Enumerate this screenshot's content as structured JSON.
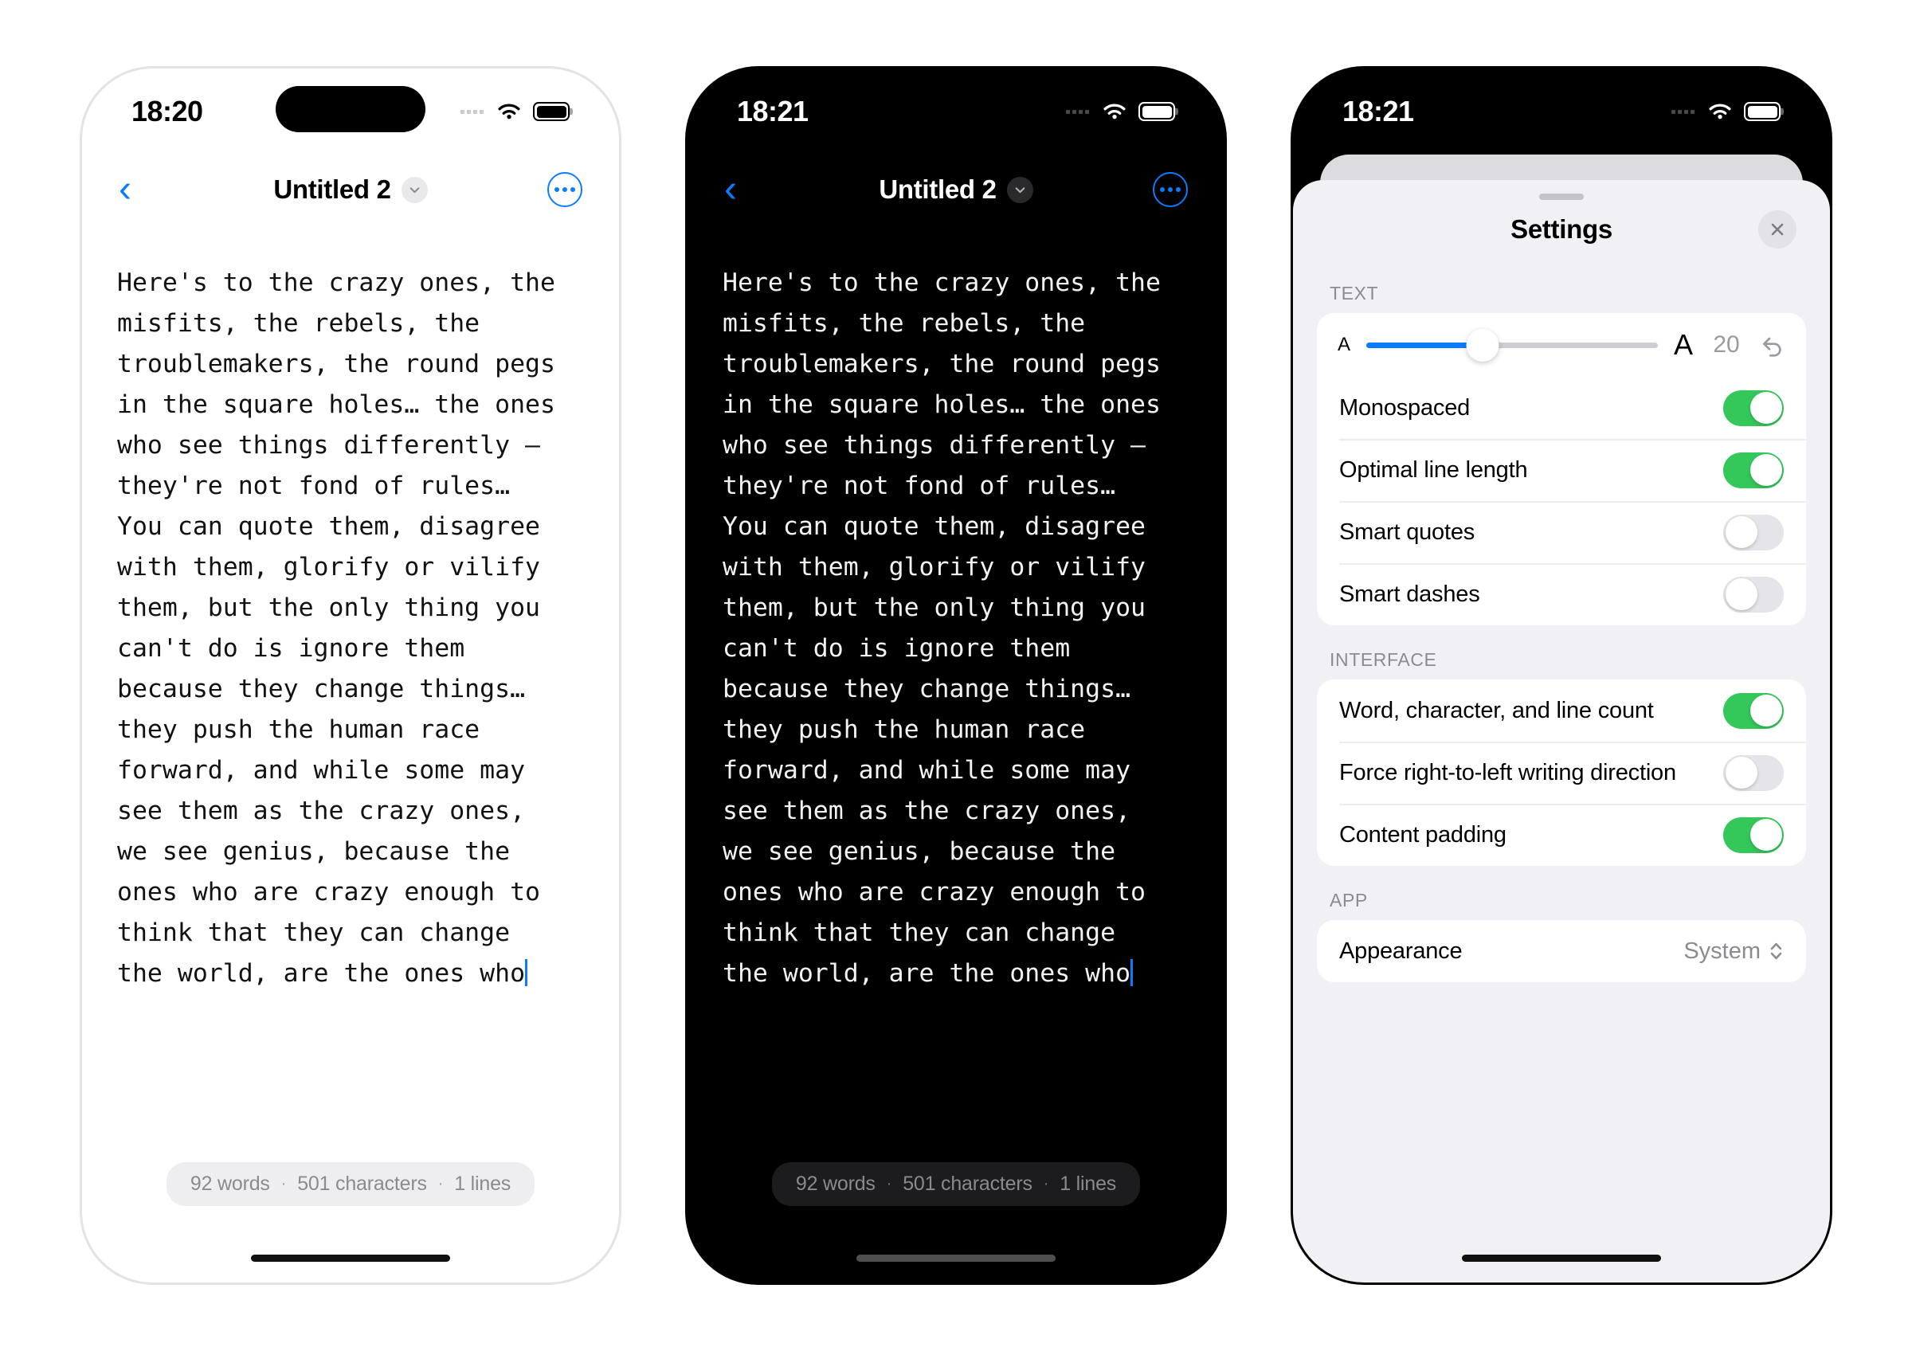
{
  "phones": [
    {
      "id": "light-editor",
      "theme": "light",
      "status": {
        "time": "18:20",
        "wifi_icon": "wifi-icon",
        "battery_icon": "battery-icon",
        "cellular_icon": "cellular-dots-icon"
      },
      "nav": {
        "back_icon": "chevron-left-icon",
        "title": "Untitled 2",
        "title_chevron_icon": "chevron-down-icon",
        "more_icon": "ellipsis-icon"
      },
      "footer": {
        "words": "92 words",
        "separator": "·",
        "characters": "501 characters",
        "lines": "1 lines"
      }
    },
    {
      "id": "dark-editor",
      "theme": "dark",
      "status": {
        "time": "18:21",
        "wifi_icon": "wifi-icon",
        "battery_icon": "battery-icon",
        "cellular_icon": "cellular-dots-icon"
      },
      "nav": {
        "back_icon": "chevron-left-icon",
        "title": "Untitled 2",
        "title_chevron_icon": "chevron-down-icon",
        "more_icon": "ellipsis-icon"
      },
      "footer": {
        "words": "92 words",
        "separator": "·",
        "characters": "501 characters",
        "lines": "1 lines"
      }
    },
    {
      "id": "settings-sheet",
      "theme": "sheet",
      "status": {
        "time": "18:21",
        "wifi_icon": "wifi-icon",
        "battery_icon": "battery-icon",
        "cellular_icon": "cellular-dots-icon"
      }
    }
  ],
  "document": {
    "lines": [
      "Here's to the crazy ones, the",
      "misfits, the rebels, the",
      "troublemakers, the round pegs",
      "in the square holes… the ones",
      "who see things differently —",
      "they're not fond of rules…",
      "You can quote them, disagree",
      "with them, glorify or vilify",
      "them, but the only thing you",
      "can't do is ignore them",
      "because they change things…",
      "they push the human race",
      "forward, and while some may",
      "see them as the crazy ones,",
      "we see genius, because the",
      "ones who are crazy enough to",
      "think that they can change",
      "the world, are the ones who"
    ]
  },
  "settings": {
    "grabber_icon": "grabber-handle-icon",
    "title": "Settings",
    "close_icon": "close-x-icon",
    "sections": [
      {
        "label": "TEXT",
        "font_size": {
          "small_a": "A",
          "large_a": "A",
          "value": "20",
          "reset_icon": "undo-arrow-icon",
          "fill_percent": 40
        },
        "rows": [
          {
            "label": "Monospaced",
            "toggle": "on"
          },
          {
            "label": "Optimal line length",
            "toggle": "on"
          },
          {
            "label": "Smart quotes",
            "toggle": "off"
          },
          {
            "label": "Smart dashes",
            "toggle": "off"
          }
        ]
      },
      {
        "label": "INTERFACE",
        "rows": [
          {
            "label": "Word, character, and line count",
            "toggle": "on"
          },
          {
            "label": "Force right-to-left writing direction",
            "toggle": "off"
          },
          {
            "label": "Content padding",
            "toggle": "on"
          }
        ]
      },
      {
        "label": "APP",
        "rows": [
          {
            "label": "Appearance",
            "value": "System",
            "chevron_icon": "up-down-chevron-icon"
          }
        ]
      }
    ]
  },
  "colors": {
    "accent_blue": "#0a7cff",
    "toggle_on_green": "#34c759",
    "sheet_background": "#f1f1f5",
    "muted_text": "#8b8b90"
  }
}
